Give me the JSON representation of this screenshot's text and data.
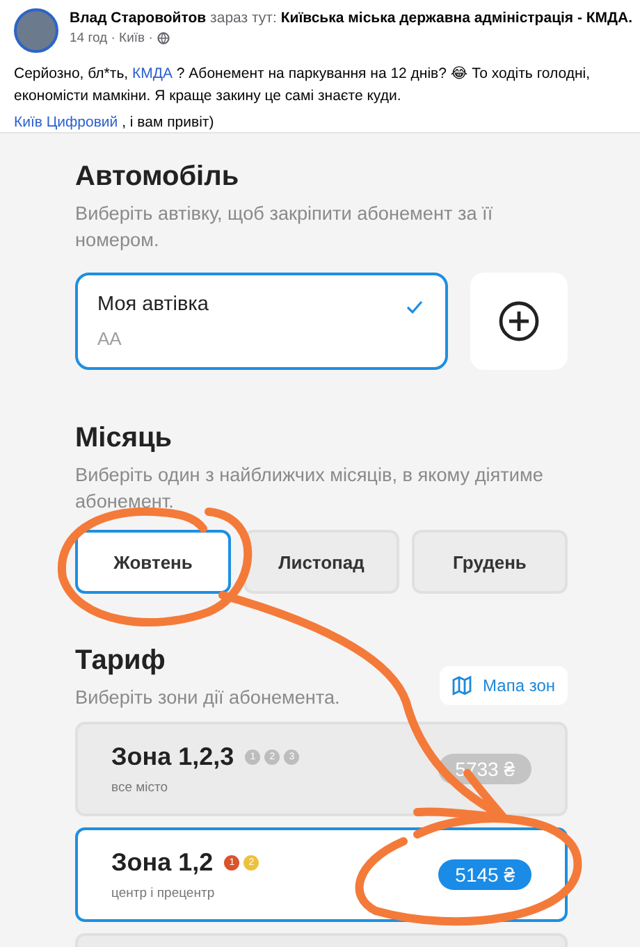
{
  "post": {
    "author": "Влад Старовойтов",
    "location_prefix": "зараз тут:",
    "location": "Київська міська державна адміністрація - КМДА.",
    "time": "14 год",
    "place": "Київ",
    "separator": "·",
    "text_before": "Серйозно, бл*ть,",
    "text_link": "КМДА",
    "text_after": "? Абонемент на паркування на 12 днів? 😂 То ходіть голодні, економісти мамкіни. Я краще закину це самі знаєте куди.",
    "mention": "Київ Цифровий",
    "mention_tail": ", і вам привіт)"
  },
  "app": {
    "car_section": {
      "title": "Автомобіль",
      "subtitle": "Виберіть автівку, щоб закріпити абонемент за її номером.",
      "cars": [
        {
          "name": "Моя автівка",
          "plate": "AA",
          "selected": true
        }
      ]
    },
    "month_section": {
      "title": "Місяць",
      "subtitle": "Виберіть один з найближчих місяців, в якому діятиме абонемент.",
      "months": [
        {
          "label": "Жовтень",
          "selected": true
        },
        {
          "label": "Листопад",
          "selected": false
        },
        {
          "label": "Грудень",
          "selected": false
        }
      ]
    },
    "tariff_section": {
      "title": "Тариф",
      "subtitle": "Виберіть зони дії абонемента.",
      "map_button": "Мапа зон",
      "zones": [
        {
          "name": "Зона 1,2,3",
          "description": "все місто",
          "price": "5733 ₴",
          "selected": false,
          "badges": [
            {
              "label": "1",
              "color": "#bdbdbd"
            },
            {
              "label": "2",
              "color": "#bdbdbd"
            },
            {
              "label": "3",
              "color": "#bdbdbd"
            }
          ]
        },
        {
          "name": "Зона 1,2",
          "description": "центр і прецентр",
          "price": "5145 ₴",
          "selected": true,
          "badges": [
            {
              "label": "1",
              "color": "#d9532b"
            },
            {
              "label": "2",
              "color": "#eec13c"
            }
          ]
        }
      ]
    }
  }
}
